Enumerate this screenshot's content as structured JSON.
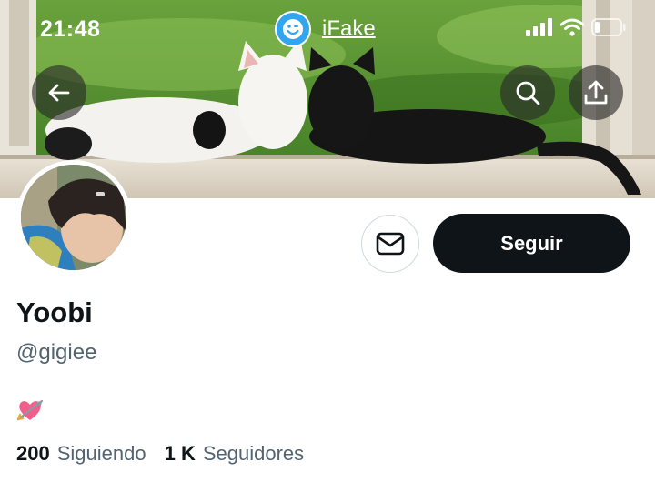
{
  "status_bar": {
    "time": "21:48",
    "brand": "iFake"
  },
  "profile": {
    "display_name": "Yoobi",
    "handle": "@gigiee",
    "bio_emoji": "heart-with-arrow",
    "follow_label": "Seguir",
    "following_count": "200",
    "following_label": "Siguiendo",
    "followers_count": "1 K",
    "followers_label": "Seguidores"
  },
  "icons": {
    "back": "arrow-left-icon",
    "search": "search-icon",
    "share": "share-icon",
    "message": "envelope-icon"
  },
  "colors": {
    "follow_button": "#0f1419",
    "secondary_text": "#536471",
    "brand_blue": "#31a5ef",
    "heart_pink": "#f35f8b"
  }
}
